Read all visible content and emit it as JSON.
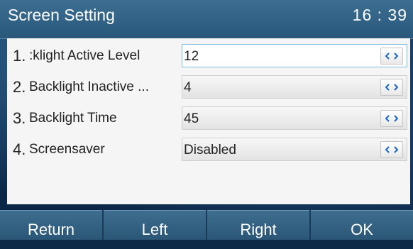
{
  "header": {
    "title": "Screen Setting",
    "clock": "16 : 39"
  },
  "rows": [
    {
      "num": "1.",
      "label": ":klight Active Level",
      "value": "12"
    },
    {
      "num": "2.",
      "label": "Backlight Inactive ...",
      "value": "4"
    },
    {
      "num": "3.",
      "label": "Backlight Time",
      "value": "45"
    },
    {
      "num": "4.",
      "label": "Screensaver",
      "value": "Disabled"
    }
  ],
  "softkeys": {
    "return": "Return",
    "left": "Left",
    "right": "Right",
    "ok": "OK"
  },
  "icons": {
    "selector": "left-right-arrow-icon"
  },
  "colors": {
    "arrow": "#1565c0",
    "title_bar": "#325f82",
    "panel": "#f5f5f5"
  }
}
